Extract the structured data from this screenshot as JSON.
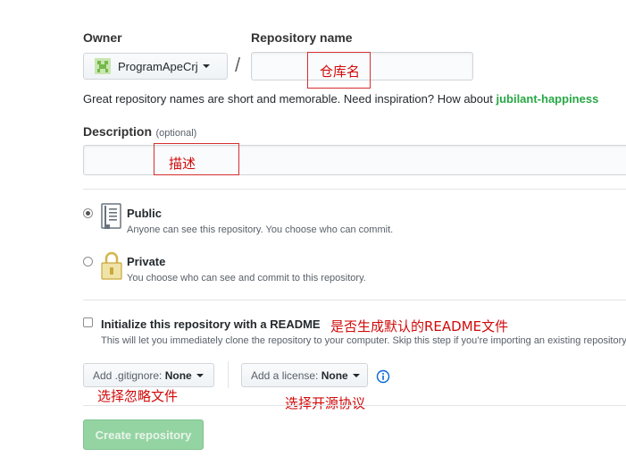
{
  "owner": {
    "label": "Owner",
    "name": "ProgramApeCrj"
  },
  "separator": "/",
  "repo_name": {
    "label": "Repository name",
    "value": "",
    "placeholder": ""
  },
  "hint": {
    "text": "Great repository names are short and memorable. Need inspiration? How about ",
    "suggestion": "jubilant-happiness"
  },
  "description": {
    "label": "Description",
    "optional": "(optional)",
    "value": ""
  },
  "visibility": {
    "public": {
      "title": "Public",
      "desc": "Anyone can see this repository. You choose who can commit.",
      "checked": true
    },
    "private": {
      "title": "Private",
      "desc": "You choose who can see and commit to this repository.",
      "checked": false
    }
  },
  "readme": {
    "label": "Initialize this repository with a README",
    "desc": "This will let you immediately clone the repository to your computer. Skip this step if you’re importing an existing repository.",
    "checked": false
  },
  "gitignore": {
    "prefix": "Add .gitignore:",
    "value": "None"
  },
  "license": {
    "prefix": "Add a license:",
    "value": "None"
  },
  "submit_label": "Create repository",
  "annotations": {
    "repo_name": "仓库名",
    "description": "描述",
    "readme": "是否生成默认的README文件",
    "gitignore": "选择忽略文件",
    "license": "选择开源协议"
  },
  "colors": {
    "accent_green": "#2c974b",
    "disabled_green": "#94d3a2",
    "annotation_red": "#d10a0a",
    "info_blue": "#0366d6"
  }
}
